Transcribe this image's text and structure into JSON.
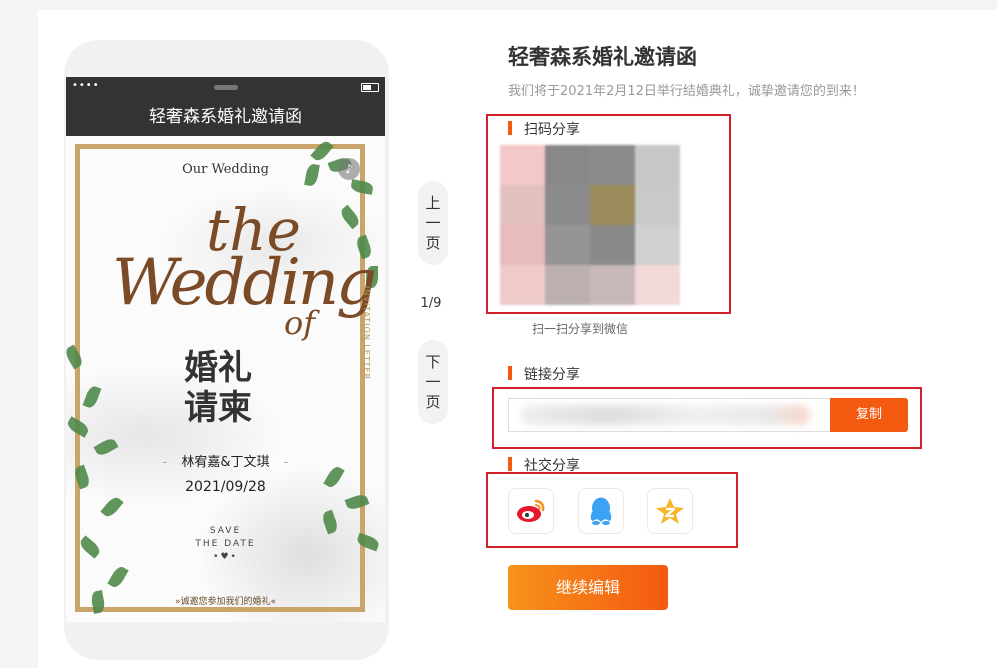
{
  "phone": {
    "title": "轻奢森系婚礼邀请函",
    "status_dots": "••••",
    "card": {
      "our_wedding": "Our Wedding",
      "script_the": "the",
      "script_wedding": "Wedding",
      "script_of": "of",
      "cn_title_line1": "婚礼",
      "cn_title_line2": "请柬",
      "couple": "林宥嘉&丁文琪",
      "couple_dash": "-",
      "date": "2021/09/28",
      "save_line1": "SAVE",
      "save_line2": "THE  DATE",
      "save_heart": "•♥•",
      "bottom_invite": "»诚邀您参加我们的婚礼«",
      "vertical_letter": "INVITATION LETTER"
    }
  },
  "pager": {
    "prev_chars": [
      "上",
      "一",
      "页"
    ],
    "next_chars": [
      "下",
      "一",
      "页"
    ],
    "indicator": "1/9"
  },
  "main": {
    "title": "轻奢森系婚礼邀请函",
    "subtitle": "我们将于2021年2月12日举行结婚典礼，诚挚邀请您的到来！"
  },
  "sections": {
    "qr_title": "扫码分享",
    "qr_caption": "扫一扫分享到微信",
    "link_title": "链接分享",
    "copy_label": "复制",
    "social_title": "社交分享"
  },
  "social": [
    {
      "name": "weibo-icon",
      "color": "#e6162d"
    },
    {
      "name": "qq-icon",
      "color": "#3ca2f5"
    },
    {
      "name": "qzone-icon",
      "color": "#f7b52a"
    }
  ],
  "actions": {
    "continue_label": "继续编辑"
  },
  "colors": {
    "accent": "#f35a0f",
    "highlight_box": "#d2202b",
    "gold": "#c9a56a",
    "script_brown": "#7b4a26"
  }
}
